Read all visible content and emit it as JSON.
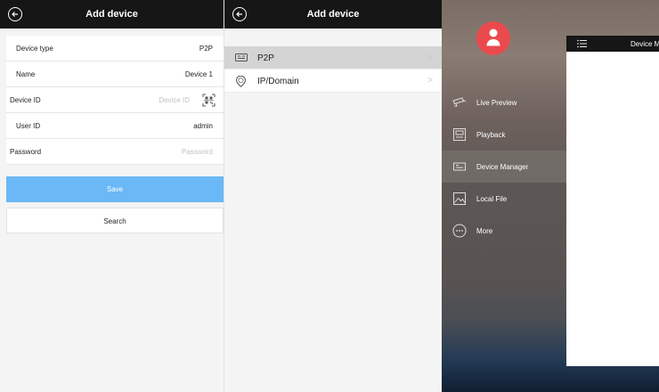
{
  "screen1": {
    "title": "Add device",
    "fields": [
      {
        "label": "Device type",
        "value": "P2P"
      },
      {
        "label": "Name",
        "value": "Device 1"
      },
      {
        "label": "Device ID",
        "placeholder": "Device ID"
      },
      {
        "label": "User ID",
        "value": "admin"
      },
      {
        "label": "Password",
        "placeholder": "Password"
      }
    ],
    "save_label": "Save",
    "search_label": "Search"
  },
  "screen2": {
    "title": "Add device",
    "items": [
      {
        "label": "P2P",
        "icon": "p2p-icon",
        "selected": true
      },
      {
        "label": "IP/Domain",
        "icon": "ip-domain-icon",
        "selected": false
      }
    ]
  },
  "screen3": {
    "menu": [
      {
        "label": "Live Preview",
        "icon": "camera-icon"
      },
      {
        "label": "Playback",
        "icon": "playback-icon"
      },
      {
        "label": "Device Manager",
        "icon": "device-manager-icon",
        "selected": true
      },
      {
        "label": "Local File",
        "icon": "image-icon"
      },
      {
        "label": "More",
        "icon": "more-icon"
      }
    ],
    "card_title": "Device M"
  },
  "colors": {
    "appbar": "#161616",
    "save_button": "#6ab8f5",
    "avatar": "#ea4a4d",
    "list_selected": "#d4d4d4"
  }
}
